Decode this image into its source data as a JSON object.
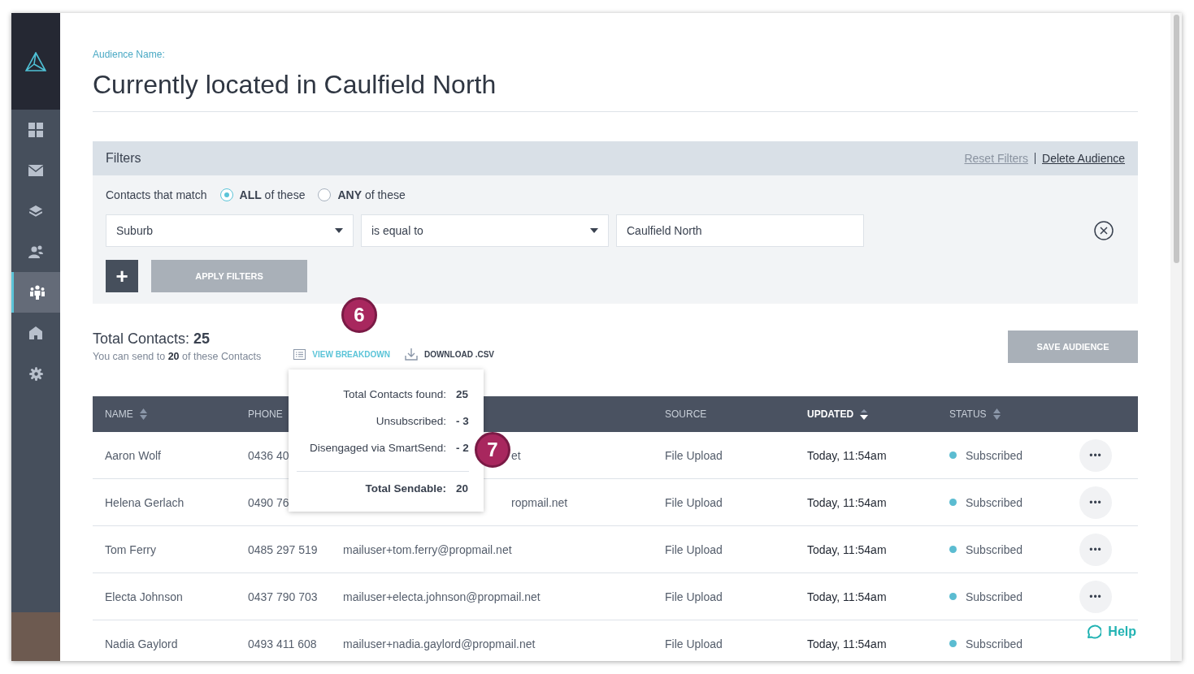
{
  "sidebar": {
    "items": [
      {
        "selected": false
      },
      {
        "selected": false
      },
      {
        "selected": false
      },
      {
        "selected": false
      },
      {
        "selected": true
      },
      {
        "selected": false
      },
      {
        "selected": false
      }
    ]
  },
  "audience": {
    "label": "Audience Name:",
    "title": "Currently located in Caulfield North"
  },
  "filters": {
    "title": "Filters",
    "links": [
      "Reset Filters",
      "Delete Audience"
    ],
    "match_label": "Contacts that match",
    "options": [
      {
        "strong": "ALL",
        "rest": "of these",
        "selected": true
      },
      {
        "strong": "ANY",
        "rest": "of these",
        "selected": false
      }
    ],
    "rule": {
      "field": "Suburb",
      "operator": "is equal to",
      "value": "Caulfield North"
    },
    "add": "+",
    "apply": "APPLY FILTERS"
  },
  "summary": {
    "total_label": "Total Contacts:",
    "total": "25",
    "send_text": "You can send to **20** of these Contacts",
    "view": "VIEW BREAKDOWN",
    "download": "DOWNLOAD .CSV",
    "save": "SAVE AUDIENCE"
  },
  "breakdown": [
    {
      "label": "Total Contacts found:",
      "value": "25",
      "kind": "line"
    },
    {
      "label": "Unsubscribed:",
      "value": "- 3",
      "kind": "line"
    },
    {
      "label": "Disengaged via SmartSend:",
      "value": "- 2",
      "kind": "line"
    },
    {
      "label": "Total Sendable:",
      "value": "20",
      "kind": "total"
    }
  ],
  "callouts": [
    "6",
    "7"
  ],
  "table": {
    "columns": [
      {
        "label": "NAME",
        "kind": "sortable",
        "selected": false
      },
      {
        "label": "PHONE",
        "kind": "plain",
        "selected": false
      },
      {
        "label": "SOURCE",
        "kind": "plain",
        "selected": false
      },
      {
        "label": "UPDATED",
        "kind": "sortable",
        "selected": true
      },
      {
        "label": "STATUS",
        "kind": "sortable",
        "selected": false
      }
    ],
    "rows": [
      {
        "name": "Aaron Wolf",
        "phone": "0436 40",
        "email_tail": "et",
        "source": "File Upload",
        "updated": "Today, 11:54am",
        "status": "Subscribed",
        "color": "#5bbcd1",
        "menu": "•••"
      },
      {
        "name": "Helena Gerlach",
        "phone": "0490 76",
        "email_tail": "ropmail.net",
        "source": "File Upload",
        "updated": "Today, 11:54am",
        "status": "Subscribed",
        "color": "#5bbcd1",
        "menu": "•••"
      },
      {
        "name": "Tom Ferry",
        "phone": "0485 297 519",
        "email": "mailuser+tom.ferry@propmail.net",
        "source": "File Upload",
        "updated": "Today, 11:54am",
        "status": "Subscribed",
        "color": "#5bbcd1",
        "menu": "•••"
      },
      {
        "name": "Electa Johnson",
        "phone": "0437 790 703",
        "email": "mailuser+electa.johnson@propmail.net",
        "source": "File Upload",
        "updated": "Today, 11:54am",
        "status": "Subscribed",
        "color": "#5bbcd1",
        "menu": "•••"
      },
      {
        "name": "Nadia Gaylord",
        "phone": "0493 411 608",
        "email": "mailuser+nadia.gaylord@propmail.net",
        "source": "File Upload",
        "updated": "Today, 11:54am",
        "status": "Subscribed",
        "color": "#5bbcd1",
        "menu": ""
      }
    ]
  },
  "help": "Help"
}
